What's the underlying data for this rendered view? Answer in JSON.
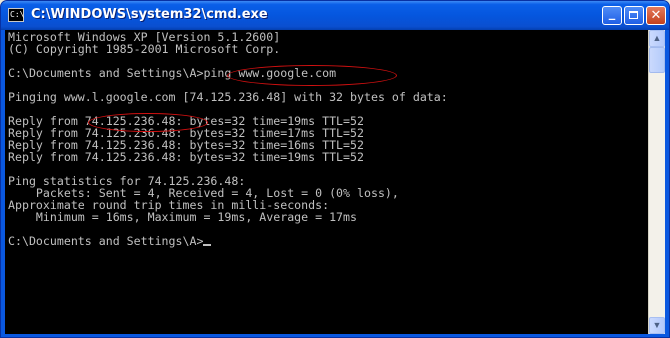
{
  "window": {
    "title": "C:\\WINDOWS\\system32\\cmd.exe",
    "icon": "cmd-icon",
    "icon_glyph": "C:\\",
    "buttons": {
      "minimize": "_",
      "close": "✕"
    }
  },
  "console": {
    "lines": [
      "Microsoft Windows XP [Version 5.1.2600]",
      "(C) Copyright 1985-2001 Microsoft Corp.",
      "",
      "C:\\Documents and Settings\\A>ping www.google.com",
      "",
      "Pinging www.l.google.com [74.125.236.48] with 32 bytes of data:",
      "",
      "Reply from 74.125.236.48: bytes=32 time=19ms TTL=52",
      "Reply from 74.125.236.48: bytes=32 time=17ms TTL=52",
      "Reply from 74.125.236.48: bytes=32 time=16ms TTL=52",
      "Reply from 74.125.236.48: bytes=32 time=19ms TTL=52",
      "",
      "Ping statistics for 74.125.236.48:",
      "    Packets: Sent = 4, Received = 4, Lost = 0 (0% loss),",
      "Approximate round trip times in milli-seconds:",
      "    Minimum = 16ms, Maximum = 19ms, Average = 17ms",
      "",
      "C:\\Documents and Settings\\A>"
    ]
  },
  "scrollbar": {
    "up_glyph": "▲",
    "down_glyph": "▼"
  },
  "colors": {
    "console_bg": "#000000",
    "console_text": "#c0c0c0",
    "annotation": "#d01010",
    "titlebar": "#0556de"
  }
}
